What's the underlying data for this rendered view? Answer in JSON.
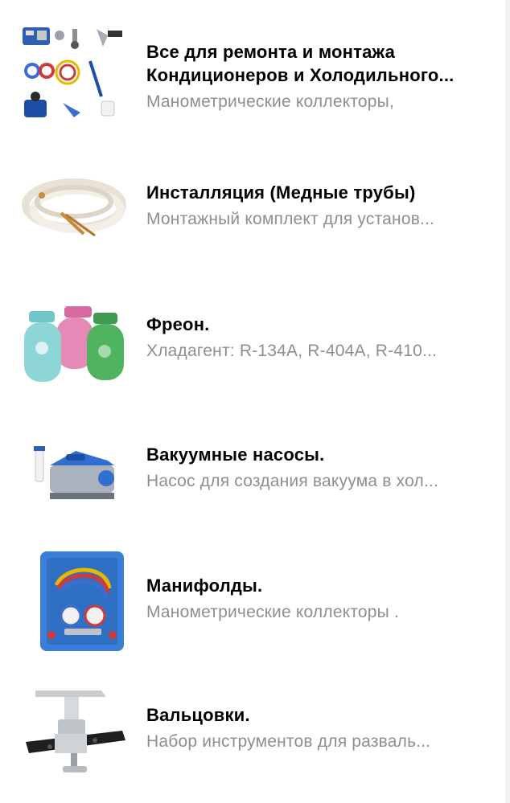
{
  "colors": {
    "title": "#000000",
    "subtitle": "#8e8e93",
    "background": "#ffffff"
  },
  "items": [
    {
      "title_line1": "Все для ремонта и монтажа",
      "title_line2": "Кондиционеров и Холодильного...",
      "subtitle": "Манометрические коллекторы,",
      "image": "hvac-tools-set-icon"
    },
    {
      "title": "Инсталляция (Медные трубы)",
      "subtitle": "Монтажный комплект для установ...",
      "image": "copper-pipes-icon"
    },
    {
      "title": "Фреон.",
      "subtitle": "Хладагент: R-134A, R-404A, R-410...",
      "image": "refrigerant-cylinders-icon"
    },
    {
      "title": "Вакуумные насосы.",
      "subtitle": "Насос для создания вакуума в хол...",
      "image": "vacuum-pump-icon"
    },
    {
      "title": "Манифолды.",
      "subtitle": "Манометрические коллекторы .",
      "image": "manifold-kit-icon"
    },
    {
      "title": "Вальцовки.",
      "subtitle": "Набор инструментов для разваль...",
      "image": "flaring-tool-icon"
    }
  ]
}
